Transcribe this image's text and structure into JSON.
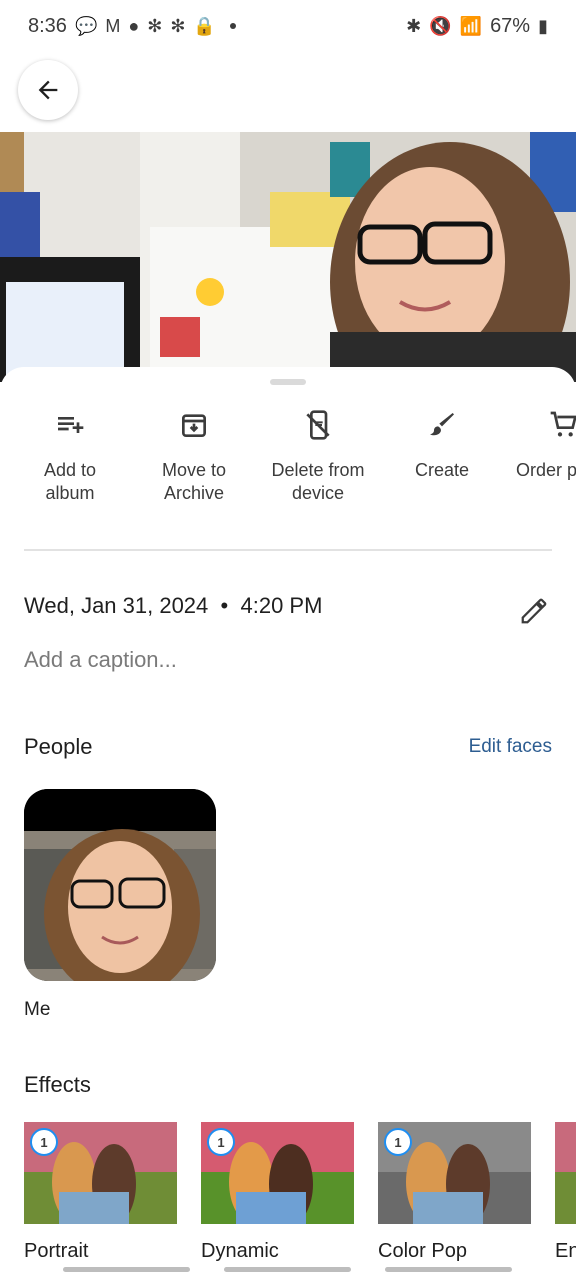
{
  "status_bar": {
    "time": "8:36",
    "battery": "67%",
    "left_icons": [
      "chat-icon",
      "gmail-icon",
      "account-icon",
      "yelp-icon",
      "yelp-icon",
      "lock-icon",
      "dot-icon"
    ],
    "right_icons": [
      "bluetooth-icon",
      "mute-icon",
      "wifi-icon",
      "signal-icon",
      "battery-icon"
    ]
  },
  "actions": [
    {
      "label": "Add to\nalbum",
      "icon": "add-to-playlist-icon"
    },
    {
      "label": "Move to\nArchive",
      "icon": "archive-icon"
    },
    {
      "label": "Delete from\ndevice",
      "icon": "delete-device-icon"
    },
    {
      "label": "Create",
      "icon": "brush-icon"
    },
    {
      "label": "Order p",
      "icon": "cart-icon"
    }
  ],
  "details": {
    "date": "Wed, Jan 31, 2024",
    "time": "4:20 PM",
    "caption_placeholder": "Add a caption..."
  },
  "people": {
    "title": "People",
    "edit_label": "Edit faces",
    "faces": [
      {
        "name": "Me"
      }
    ]
  },
  "effects": {
    "title": "Effects",
    "items": [
      {
        "label": "Portrait",
        "badge": "1"
      },
      {
        "label": "Dynamic",
        "badge": "1"
      },
      {
        "label": "Color Pop",
        "badge": "1"
      },
      {
        "label": "En",
        "badge": ""
      }
    ]
  },
  "colors": {
    "accent": "#2d5d91",
    "text": "#1f1f1f",
    "muted": "#7a7a7a"
  }
}
